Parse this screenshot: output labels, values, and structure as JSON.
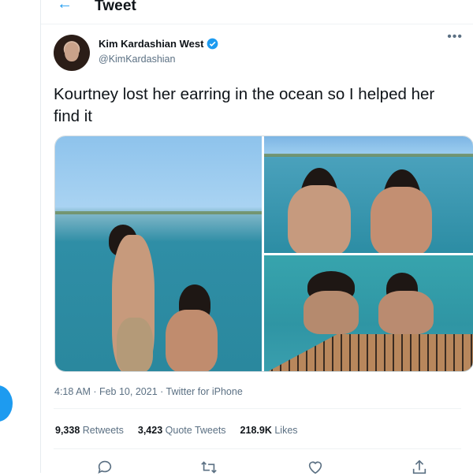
{
  "header": {
    "title": "Tweet"
  },
  "author": {
    "name": "Kim Kardashian West",
    "handle": "@KimKardashian"
  },
  "tweet": {
    "text": "Kourtney lost her earring in the ocean so I helped her find it",
    "meta": "4:18 AM · Feb 10, 2021 · Twitter for iPhone",
    "stats": {
      "retweets_count": "9,338",
      "retweets_label": "Retweets",
      "quotes_count": "3,423",
      "quotes_label": "Quote Tweets",
      "likes_count": "218.9K",
      "likes_label": "Likes"
    }
  },
  "icons": {
    "back": "back-arrow-icon",
    "verified": "verified-badge-icon",
    "more": "more-icon",
    "reply": "reply-icon",
    "retweet": "retweet-icon",
    "like": "like-icon",
    "share": "share-icon"
  },
  "colors": {
    "accent": "#1d9bf0",
    "text": "#0f1419",
    "secondary": "#5b7083"
  }
}
